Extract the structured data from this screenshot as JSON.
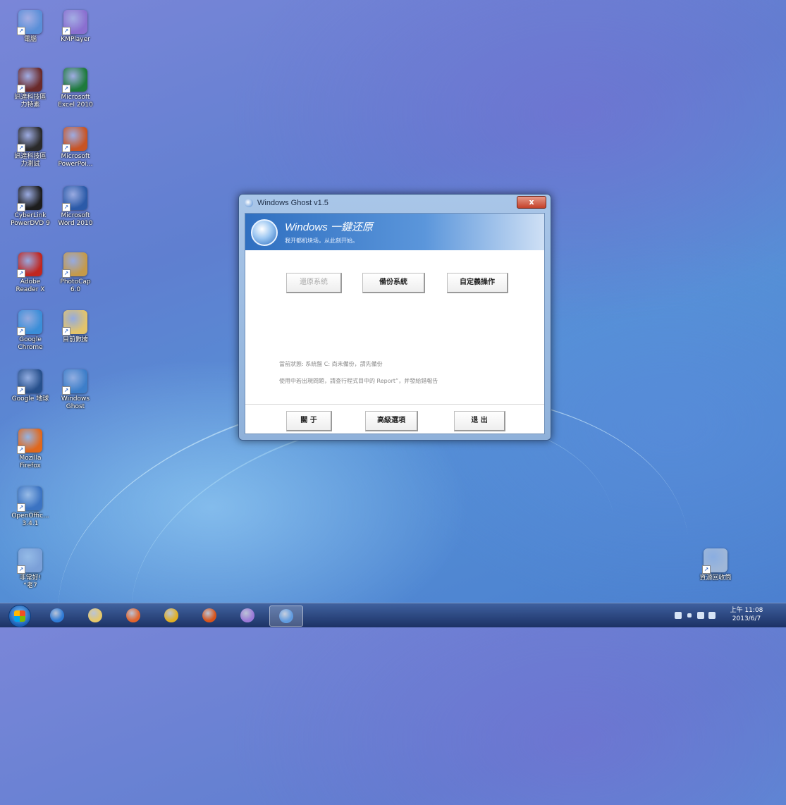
{
  "desktop_icons": [
    {
      "label": "電腦",
      "icon": "computer-icon",
      "color": "#5a8fd8"
    },
    {
      "label": "KMPlayer",
      "icon": "kmplayer-icon",
      "color": "#8a6fd0"
    },
    {
      "label": "訊達科技區\n力特素",
      "icon": "app-icon",
      "color": "#6a2a2a"
    },
    {
      "label": "Microsoft\nExcel 2010",
      "icon": "excel-icon",
      "color": "#1e7a3c"
    },
    {
      "label": "訊達科技區\n力測試",
      "icon": "app-icon",
      "color": "#2a2a2a"
    },
    {
      "label": "Microsoft\nPowerPoi...",
      "icon": "powerpoint-icon",
      "color": "#c85424"
    },
    {
      "label": "CyberLink\nPowerDVD 9",
      "icon": "powerdvd-icon",
      "color": "#1d1d1d"
    },
    {
      "label": "Microsoft\nWord 2010",
      "icon": "word-icon",
      "color": "#2b5aa8"
    },
    {
      "label": "Adobe\nReader X",
      "icon": "adobe-reader-icon",
      "color": "#c0261f"
    },
    {
      "label": "PhotoCap\n6.0",
      "icon": "photocap-icon",
      "color": "#c59a4a"
    },
    {
      "label": "Google\nChrome",
      "icon": "chrome-icon",
      "color": "#3b8ed8"
    },
    {
      "label": "目前數據",
      "icon": "folder-icon",
      "color": "#e3c46b"
    },
    {
      "label": "Google 地球",
      "icon": "google-earth-icon",
      "color": "#27508c"
    },
    {
      "label": "Windows\nGhost",
      "icon": "windows-ghost-icon",
      "color": "#3d7ec9"
    },
    {
      "label": "Mozilla\nFirefox",
      "icon": "firefox-icon",
      "color": "#e0671b"
    },
    {
      "label": "OpenOffic...\n3.4.1",
      "icon": "openoffice-icon",
      "color": "#3b73c2"
    },
    {
      "label": "非常好!\n“老7",
      "icon": "star-icon",
      "color": "#7ba0d8"
    },
    {
      "label": "資源回收筒",
      "icon": "recycle-bin-icon",
      "color": "#9fb7d8"
    }
  ],
  "dialog": {
    "title": "Windows Ghost v1.5",
    "close_label": "x",
    "banner_title": "Windows 一鍵还原",
    "banner_subtitle": "我开都机块场，从此刻开始。",
    "buttons": {
      "restore": "還原系統",
      "backup": "備份系統",
      "custom": "自定義操作"
    },
    "status_line1": "當前狀態: 系統盤 C: 尚未備份，請先備份",
    "status_line2": "使用中若出現問題，請查行程式目中的 Report”，并發給錯報告",
    "footer": {
      "about": "關  于",
      "advanced": "高級選項",
      "exit": "退  出"
    }
  },
  "taskbar": {
    "pinned": [
      {
        "icon": "internet-explorer-icon",
        "color": "#2f7bd6"
      },
      {
        "icon": "file-explorer-icon",
        "color": "#e6c86a"
      },
      {
        "icon": "media-player-icon",
        "color": "#e2642c"
      },
      {
        "icon": "chrome-icon",
        "color": "#e2b024"
      },
      {
        "icon": "firefox-icon",
        "color": "#d8541a"
      },
      {
        "icon": "kmplayer-icon",
        "color": "#9b7ad8"
      },
      {
        "icon": "windows-ghost-icon",
        "color": "#5f9be0"
      }
    ],
    "clock_time": "上午 11:08",
    "clock_date": "2013/6/7"
  }
}
